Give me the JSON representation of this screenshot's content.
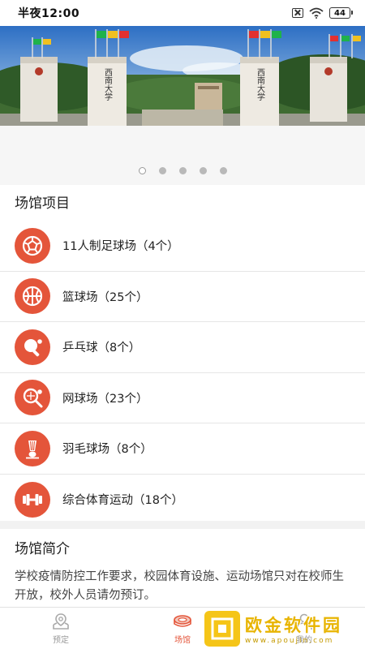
{
  "status_bar": {
    "time": "半夜12:00",
    "battery": "44"
  },
  "banner": {
    "dots": 5,
    "active_dot": 0
  },
  "venues": {
    "title": "场馆项目",
    "items": [
      {
        "label": "11人制足球场（4个）",
        "icon": "soccer-ball-icon"
      },
      {
        "label": "篮球场（25个）",
        "icon": "basketball-icon"
      },
      {
        "label": "乒乓球（8个）",
        "icon": "ping-pong-icon"
      },
      {
        "label": "网球场（23个）",
        "icon": "tennis-icon"
      },
      {
        "label": "羽毛球场（8个）",
        "icon": "badminton-icon"
      },
      {
        "label": "综合体育运动（18个）",
        "icon": "dumbbell-icon"
      }
    ]
  },
  "intro": {
    "title": "场馆简介",
    "text": "学校疫情防控工作要求，校园体育设施、运动场馆只对在校师生开放，校外人员请勿预订。"
  },
  "tabs": [
    {
      "label": "预定",
      "icon": "reserve-icon",
      "active": false
    },
    {
      "label": "场馆",
      "icon": "stadium-icon",
      "active": true
    },
    {
      "label": "我的",
      "icon": "profile-icon",
      "active": false
    }
  ],
  "watermark": {
    "title": "欧金软件园",
    "url": "www.apoujin.com"
  },
  "colors": {
    "accent": "#e4553a",
    "background": "#f2f2f2"
  }
}
